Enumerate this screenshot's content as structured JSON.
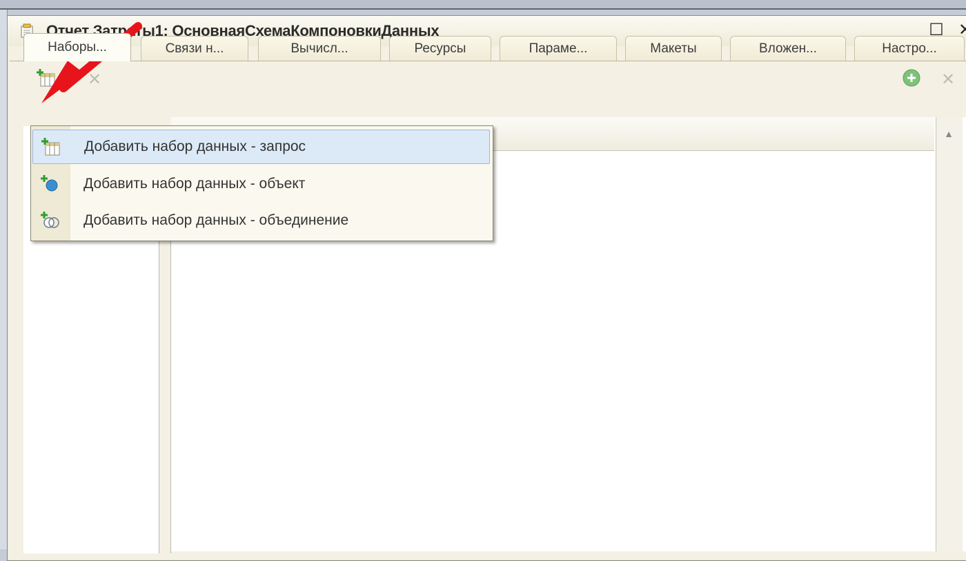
{
  "window": {
    "title": "Отчет Затраты1: ОсновнаяСхемаКомпоновкиДанных",
    "minimize": "_",
    "maximize": "☐",
    "close": "✕"
  },
  "tabs": [
    {
      "label": "Наборы..."
    },
    {
      "label": "Связи н..."
    },
    {
      "label": "Вычисл..."
    },
    {
      "label": "Ресурсы"
    },
    {
      "label": "Параме..."
    },
    {
      "label": "Макеты"
    },
    {
      "label": "Вложен..."
    },
    {
      "label": "Настро..."
    }
  ],
  "menu": {
    "items": [
      {
        "label": "Добавить набор данных - запрос",
        "icon": "add-query-dataset-icon"
      },
      {
        "label": "Добавить набор данных - объект",
        "icon": "add-object-dataset-icon"
      },
      {
        "label": "Добавить набор данных - объединение",
        "icon": "add-union-dataset-icon"
      }
    ]
  },
  "colors": {
    "accent_arrow": "#e8141b",
    "highlight": "#dce9f7",
    "window_bg": "#f4f1e4"
  }
}
